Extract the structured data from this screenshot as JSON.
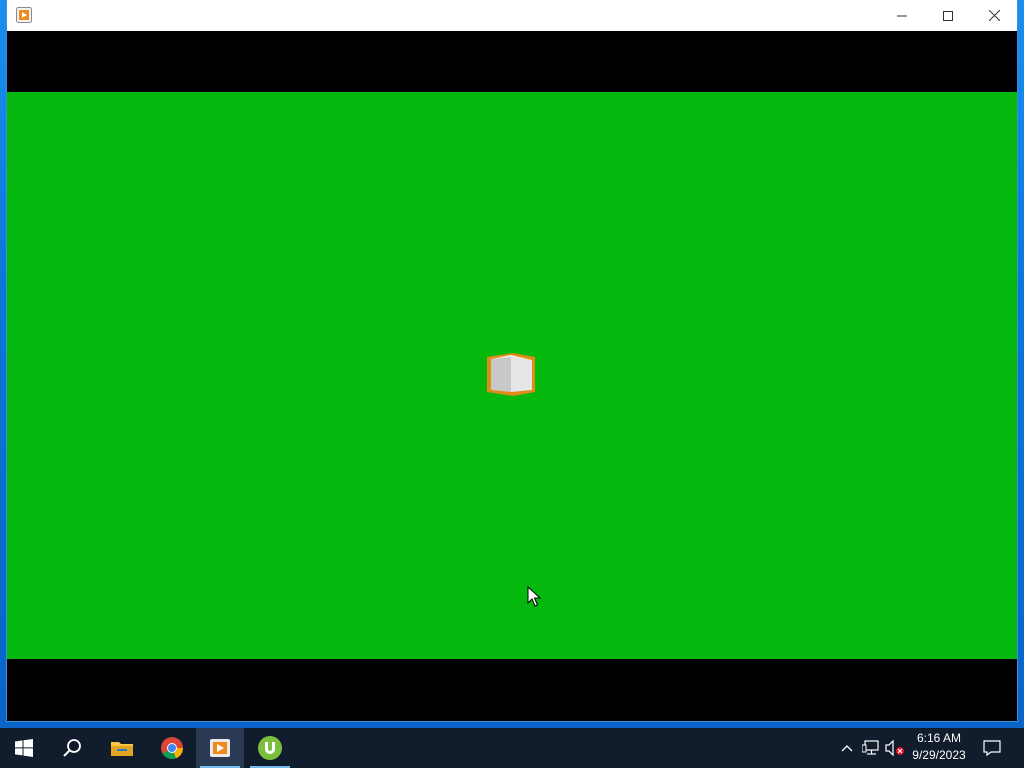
{
  "window": {
    "app_icon": "media-player-icon",
    "controls": [
      "minimize-icon",
      "maximize-icon",
      "close-icon"
    ]
  },
  "video": {
    "background_color": "#05b80d",
    "letterbox_color": "#000000",
    "object": "cube"
  },
  "taskbar": {
    "items": [
      {
        "name": "start-button",
        "icon": "windows-icon"
      },
      {
        "name": "search-button",
        "icon": "search-icon"
      },
      {
        "name": "file-explorer",
        "icon": "folder-icon"
      },
      {
        "name": "chrome",
        "icon": "chrome-icon"
      },
      {
        "name": "media-player",
        "icon": "media-player-icon",
        "active": true
      },
      {
        "name": "utorrent",
        "icon": "utorrent-icon",
        "running": true
      }
    ],
    "tray": {
      "icons": [
        "chevron-up-icon",
        "network-icon",
        "volume-muted-icon"
      ],
      "time": "6:16 AM",
      "date": "9/29/2023",
      "notifications_icon": "notification-icon"
    }
  }
}
